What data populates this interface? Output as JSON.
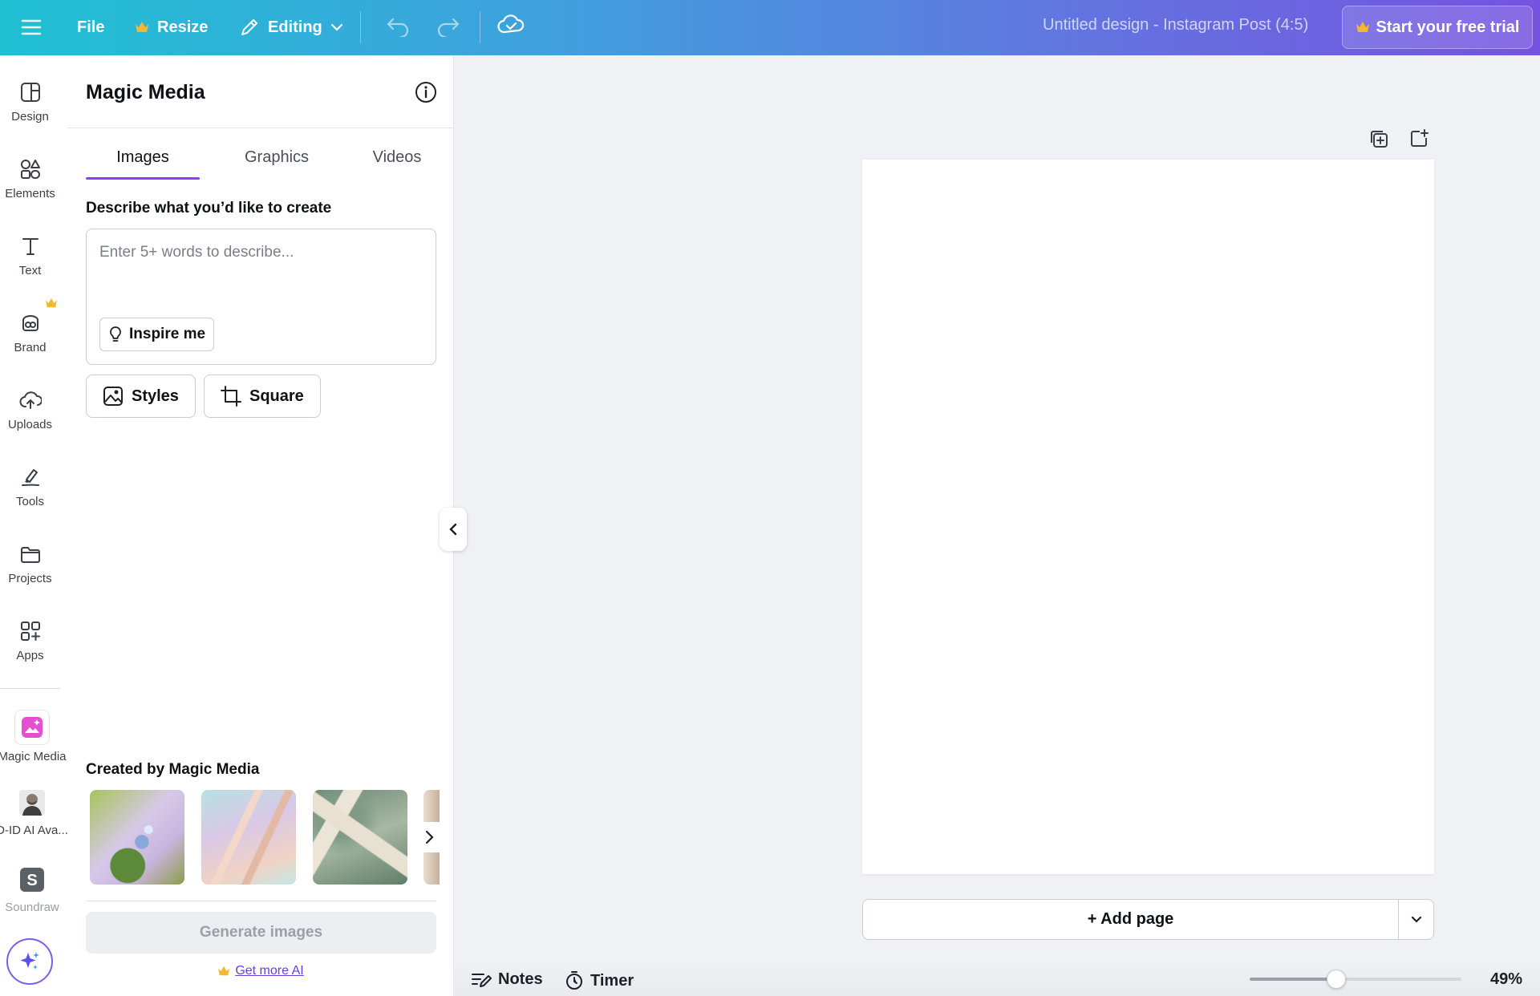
{
  "topbar": {
    "file_label": "File",
    "resize_label": "Resize",
    "editing_label": "Editing",
    "doc_title": "Untitled design - Instagram Post (4:5)",
    "trial_label": "Start your free trial"
  },
  "rail": {
    "items": [
      {
        "label": "Design",
        "icon": "design-icon"
      },
      {
        "label": "Elements",
        "icon": "elements-icon"
      },
      {
        "label": "Text",
        "icon": "text-icon"
      },
      {
        "label": "Brand",
        "icon": "brand-icon"
      },
      {
        "label": "Uploads",
        "icon": "upload-cloud-icon"
      },
      {
        "label": "Tools",
        "icon": "tools-icon"
      },
      {
        "label": "Projects",
        "icon": "folder-icon"
      },
      {
        "label": "Apps",
        "icon": "apps-icon"
      }
    ],
    "apps": [
      {
        "label": "Magic Media",
        "icon": "magic-media-icon"
      },
      {
        "label": "D-ID AI Ava...",
        "icon": "avatar-icon"
      },
      {
        "label": "Soundraw",
        "icon": "soundraw-icon"
      }
    ]
  },
  "panel": {
    "title": "Magic Media",
    "tabs": [
      {
        "label": "Images",
        "active": true
      },
      {
        "label": "Graphics",
        "active": false
      },
      {
        "label": "Videos",
        "active": false
      }
    ],
    "describe_label": "Describe what you’d like to create",
    "prompt_placeholder": "Enter 5+ words to describe...",
    "inspire_label": "Inspire me",
    "styles_label": "Styles",
    "square_label": "Square",
    "created_label": "Created by Magic Media",
    "generate_label": "Generate images",
    "get_more_label": "Get more AI"
  },
  "canvas": {
    "add_page_label": "+ Add page"
  },
  "bottombar": {
    "notes_label": "Notes",
    "timer_label": "Timer",
    "zoom_percent": 49,
    "zoom_label": "49%",
    "zoom_slider_fraction": 0.41
  },
  "colors": {
    "accent": "#8b3dff",
    "crown": "#f5b731",
    "link": "#6b3fd6"
  }
}
